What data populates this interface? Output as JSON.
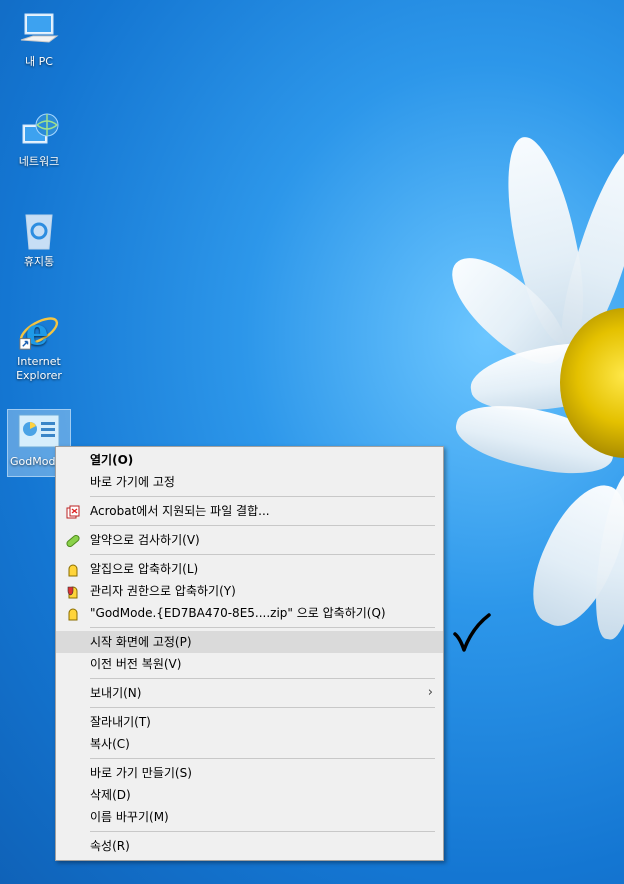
{
  "desktop_icons": [
    {
      "label": "내 PC",
      "icon": "pc-icon"
    },
    {
      "label": "네트워크",
      "icon": "network-icon"
    },
    {
      "label": "휴지통",
      "icon": "recycle-bin-icon"
    },
    {
      "label": "Internet Explorer",
      "icon": "internet-explorer-icon"
    },
    {
      "label": "GodMode",
      "icon": "control-panel-icon"
    }
  ],
  "context_menu": {
    "items": [
      {
        "label": "열기(O)",
        "bold": true
      },
      {
        "label": "바로 가기에 고정"
      },
      {
        "label": "Acrobat에서 지원되는 파일 결합...",
        "icon": "acrobat-icon"
      },
      {
        "label": "알약으로 검사하기(V)",
        "icon": "alyac-pill-icon"
      },
      {
        "label": "알집으로 압축하기(L)",
        "icon": "alzip-icon"
      },
      {
        "label": "관리자 권한으로 압축하기(Y)",
        "icon": "alzip-admin-icon"
      },
      {
        "label": "\"GodMode.{ED7BA470-8E5....zip\" 으로 압축하기(Q)",
        "icon": "alzip-icon"
      },
      {
        "label": "시작 화면에 고정(P)",
        "highlighted": true
      },
      {
        "label": "이전 버전 복원(V)"
      },
      {
        "label": "보내기(N)",
        "submenu": true
      },
      {
        "label": "잘라내기(T)"
      },
      {
        "label": "복사(C)"
      },
      {
        "label": "바로 가기 만들기(S)"
      },
      {
        "label": "삭제(D)"
      },
      {
        "label": "이름 바꾸기(M)"
      },
      {
        "label": "속성(R)"
      }
    ],
    "submenu_arrow": "›"
  },
  "annotation": {
    "icon": "checkmark-icon"
  },
  "colors": {
    "desktop_blue": "#1f7fd6",
    "menu_bg": "#f0f0f0",
    "hover": "#dadada"
  }
}
